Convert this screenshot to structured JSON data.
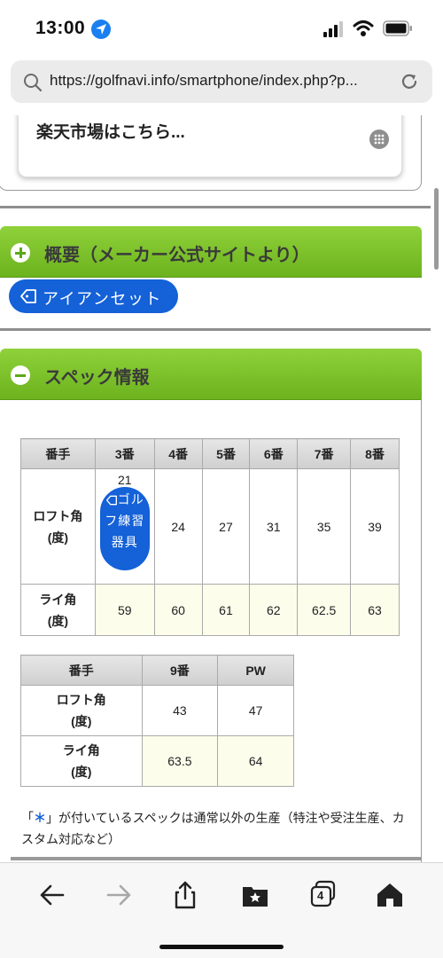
{
  "status_bar": {
    "time": "13:00"
  },
  "url_bar": {
    "url": "https://golfnavi.info/smartphone/index.php?p..."
  },
  "shop_card": {
    "label": "楽天市場はこちら..."
  },
  "overview_section": {
    "title": "概要（メーカー公式サイトより）",
    "tag_label": "アイアンセット"
  },
  "spec_section": {
    "title": "スペック情報",
    "table1": {
      "header_label": "番手",
      "columns": [
        "3番",
        "4番",
        "5番",
        "6番",
        "7番",
        "8番"
      ],
      "loft_label_1": "ロフト角",
      "loft_label_2": "(度)",
      "loft_values": [
        "21",
        "24",
        "27",
        "31",
        "35",
        "39"
      ],
      "lie_label_1": "ライ角",
      "lie_label_2": "(度)",
      "lie_values": [
        "59",
        "60",
        "61",
        "62",
        "62.5",
        "63"
      ],
      "inline_tag": "ゴルフ練習器具"
    },
    "table2": {
      "header_label": "番手",
      "columns": [
        "9番",
        "PW"
      ],
      "loft_label_1": "ロフト角",
      "loft_label_2": "(度)",
      "loft_values": [
        "43",
        "47"
      ],
      "lie_label_1": "ライ角",
      "lie_label_2": "(度)",
      "lie_values": [
        "63.5",
        "64"
      ]
    },
    "note_prefix": "「",
    "note_star": "＊",
    "note_text": "」が付いているスペックは通常以外の生産（特注や受注生産、カスタム対応など）"
  },
  "toolbar": {
    "tabs_count": "4"
  },
  "colors": {
    "accent_blue": "#1461d8",
    "header_green": "#7cc22a"
  },
  "icons": [
    "location-arrow-icon",
    "signal-icon",
    "wifi-icon",
    "battery-icon",
    "search-icon",
    "reload-icon",
    "grid-icon",
    "plus-circle-icon",
    "minus-circle-icon",
    "tag-icon",
    "back-arrow-icon",
    "forward-arrow-icon",
    "share-icon",
    "bookmarks-icon",
    "tabs-icon",
    "home-icon"
  ]
}
